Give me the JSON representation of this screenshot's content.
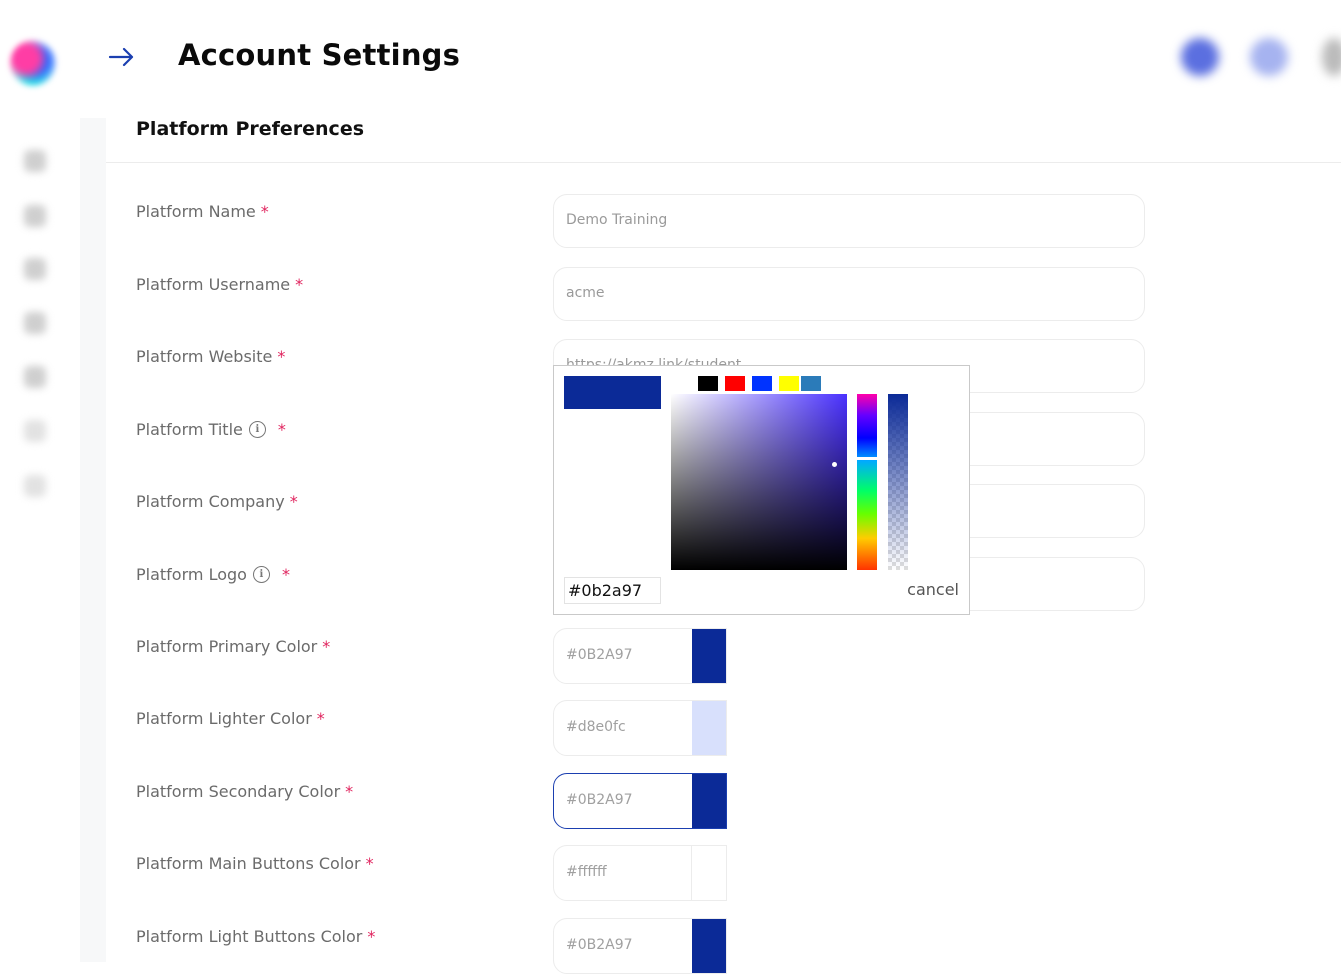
{
  "header": {
    "title": "Account Settings"
  },
  "section": {
    "title": "Platform Preferences"
  },
  "fields": [
    {
      "label": "Platform Name",
      "required": "*",
      "value": "Demo Training"
    },
    {
      "label": "Platform Username",
      "required": "*",
      "value": "acme"
    },
    {
      "label": "Platform Website",
      "required": "*",
      "value": "https://akmz.link/student"
    },
    {
      "label": "Platform Title",
      "required": "*",
      "value": ""
    },
    {
      "label": "Platform Company",
      "required": "*",
      "value": ""
    },
    {
      "label": "Platform Logo",
      "required": "*",
      "value": ""
    }
  ],
  "colors": [
    {
      "label": "Platform Primary Color",
      "required": "*",
      "value": "#0B2A97",
      "swatch": "#0b2a97"
    },
    {
      "label": "Platform Lighter Color",
      "required": "*",
      "value": "#d8e0fc",
      "swatch": "#d8e0fc"
    },
    {
      "label": "Platform Secondary Color",
      "required": "*",
      "value": "#0B2A97",
      "swatch": "#0b2a97"
    },
    {
      "label": "Platform Main Buttons Color",
      "required": "*",
      "value": "#ffffff",
      "swatch": "#ffffff"
    },
    {
      "label": "Platform Light Buttons Color",
      "required": "*",
      "value": "#0B2A97",
      "swatch": "#0b2a97"
    }
  ],
  "picker": {
    "hex": "#0b2a97",
    "cancel_label": "cancel",
    "presets": [
      "#ffffff",
      "#000000",
      "#ff0000",
      "#0033ff",
      "#ffff00",
      "#2b7bb9"
    ]
  },
  "icons": {
    "back": "arrow-right-icon",
    "info": "info-icon"
  },
  "theme": {
    "accent": "#0b2a97",
    "required": "#e0245e"
  }
}
